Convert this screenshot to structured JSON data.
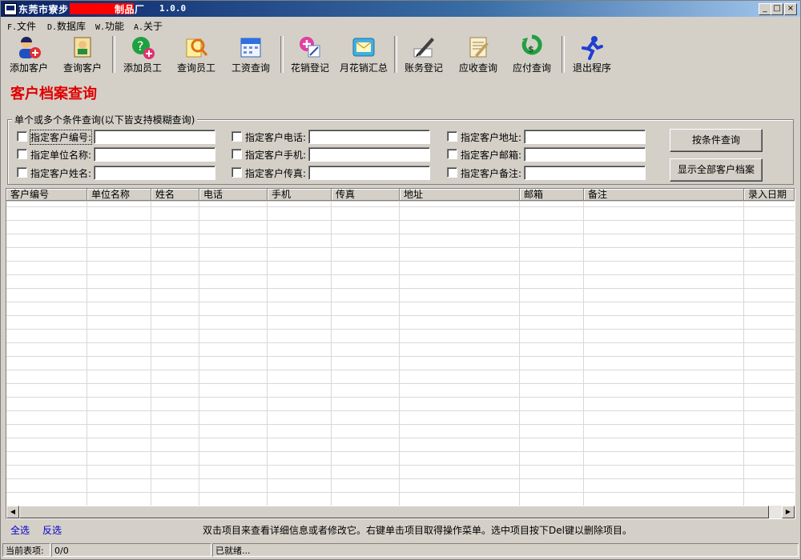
{
  "window": {
    "title": "东莞市寮步",
    "title_suffix": "制品厂",
    "version": "1.0.0",
    "controls": [
      "minimize-icon",
      "maximize-icon",
      "close-icon"
    ]
  },
  "menu": [
    {
      "key": "F.",
      "label": "文件"
    },
    {
      "key": "D.",
      "label": "数据库"
    },
    {
      "key": "W.",
      "label": "功能"
    },
    {
      "key": "A.",
      "label": "关于"
    }
  ],
  "toolbar": [
    {
      "label": "添加客户",
      "icon": "add-customer-icon"
    },
    {
      "label": "查询客户",
      "icon": "query-customer-icon"
    },
    {
      "label": "添加员工",
      "icon": "add-employee-icon"
    },
    {
      "label": "查询员工",
      "icon": "query-employee-icon"
    },
    {
      "label": "工资查询",
      "icon": "salary-calendar-icon"
    },
    {
      "label": "花销登记",
      "icon": "expense-register-icon"
    },
    {
      "label": "月花销汇总",
      "icon": "monthly-expense-icon"
    },
    {
      "label": "账务登记",
      "icon": "account-register-icon"
    },
    {
      "label": "应收查询",
      "icon": "receivable-query-icon"
    },
    {
      "label": "应付查询",
      "icon": "payable-query-icon"
    },
    {
      "label": "退出程序",
      "icon": "exit-runner-icon"
    }
  ],
  "page_title": "客户档案查询",
  "filter": {
    "legend": "单个或多个条件查询(以下皆支持模糊查询)",
    "fields": [
      {
        "label": "指定客户编号:",
        "value": "",
        "checked": false
      },
      {
        "label": "指定单位名称:",
        "value": "",
        "checked": false
      },
      {
        "label": "指定客户姓名:",
        "value": "",
        "checked": false
      },
      {
        "label": "指定客户电话:",
        "value": "",
        "checked": false
      },
      {
        "label": "指定客户手机:",
        "value": "",
        "checked": false
      },
      {
        "label": "指定客户传真:",
        "value": "",
        "checked": false
      },
      {
        "label": "指定客户地址:",
        "value": "",
        "checked": false
      },
      {
        "label": "指定客户邮箱:",
        "value": "",
        "checked": false
      },
      {
        "label": "指定客户备注:",
        "value": "",
        "checked": false
      }
    ],
    "search_button": "按条件查询",
    "show_all_button": "显示全部客户档案"
  },
  "table": {
    "columns": [
      "客户编号",
      "单位名称",
      "姓名",
      "电话",
      "手机",
      "传真",
      "地址",
      "邮箱",
      "备注",
      "录入日期"
    ],
    "rows": []
  },
  "footer": {
    "select_all": "全选",
    "invert": "反选",
    "hint": "双击项目来查看详细信息或者修改它。右键单击项目取得操作菜单。选中项目按下Del键以删除项目。"
  },
  "status": {
    "current_label": "当前表项:",
    "current_value": "0/0",
    "message": "已就绪..."
  }
}
